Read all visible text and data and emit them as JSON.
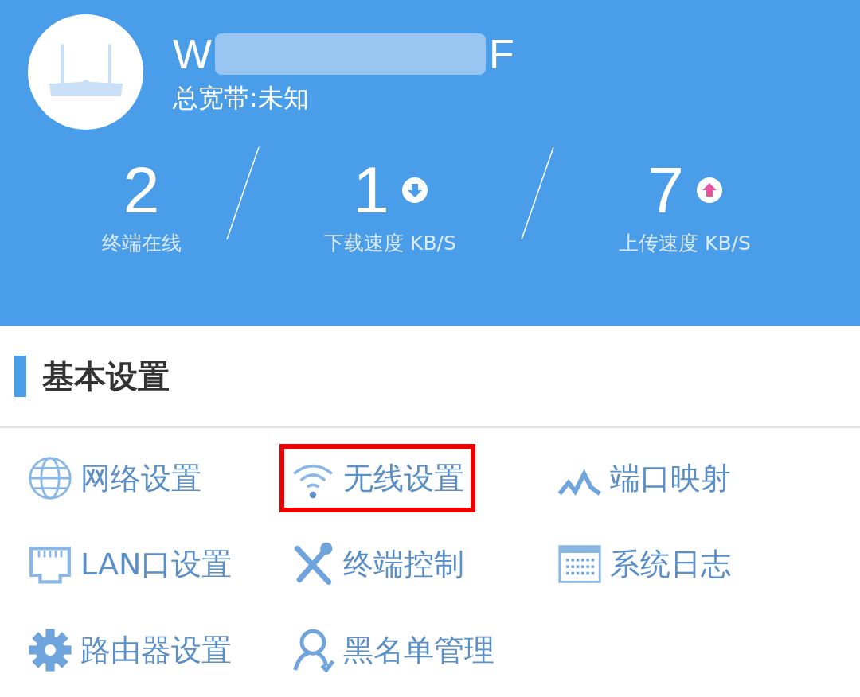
{
  "device": {
    "name_start": "W",
    "name_end": "F",
    "bandwidth": "总宽带:未知"
  },
  "stats": [
    {
      "kind": "plain",
      "value": "2",
      "label": "终端在线"
    },
    {
      "kind": "download",
      "value": "1",
      "label": "下载速度 KB/S"
    },
    {
      "kind": "upload",
      "value": "7",
      "label": "上传速度 KB/S"
    }
  ],
  "section": {
    "title": "基本设置"
  },
  "menu": [
    {
      "kind": "globe",
      "label": "网络设置",
      "highlighted": false
    },
    {
      "kind": "wifi",
      "label": "无线设置",
      "highlighted": true
    },
    {
      "kind": "wave",
      "label": "端口映射",
      "highlighted": false
    },
    {
      "kind": "lan",
      "label": "LAN口设置",
      "highlighted": false
    },
    {
      "kind": "tools",
      "label": "终端控制",
      "highlighted": false
    },
    {
      "kind": "calendar",
      "label": "系统日志",
      "highlighted": false
    },
    {
      "kind": "gear",
      "label": "路由器设置",
      "highlighted": false
    },
    {
      "kind": "user",
      "label": "黑名单管理",
      "highlighted": false
    }
  ]
}
